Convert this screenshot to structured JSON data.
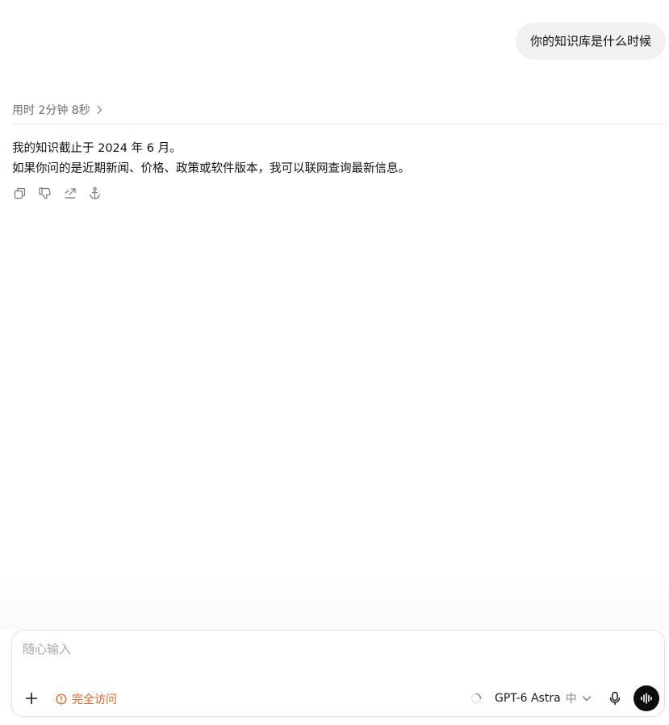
{
  "conversation": {
    "user_message": "你的知识库是什么时候",
    "thinking": {
      "label": "用时 2分钟 8秒",
      "chevron_icon": "chevron-right-icon"
    },
    "assistant_answer": {
      "line1": "我的知识截止于 2024 年 6 月。",
      "line2": "如果你问的是近期新闻、价格、政策或软件版本，我可以联网查询最新信息。"
    },
    "actions": [
      {
        "icon": "copy-icon"
      },
      {
        "icon": "thumbs-down-icon"
      },
      {
        "icon": "share-icon"
      },
      {
        "icon": "anchor-icon"
      }
    ]
  },
  "composer": {
    "placeholder": "随心输入",
    "value": "",
    "add_icon": "plus-icon",
    "access": {
      "label": "完全访问",
      "icon": "alert-circle-icon",
      "color": "#e0632a"
    },
    "model": {
      "name": "GPT-6 Astra",
      "effort": "中",
      "dropdown_icon": "chevron-down-icon"
    },
    "mic_icon": "microphone-icon",
    "voice_icon": "voice-waveform-icon"
  }
}
